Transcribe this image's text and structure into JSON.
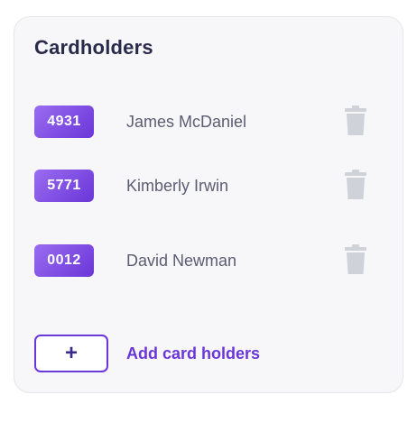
{
  "panel": {
    "title": "Cardholders",
    "cardholders": [
      {
        "card_last4": "4931",
        "name": "James McDaniel",
        "action_icon": "trash-icon"
      },
      {
        "card_last4": "5771",
        "name": "Kimberly Irwin",
        "action_icon": "trash-icon"
      },
      {
        "card_last4": "0012",
        "name": "David Newman",
        "action_icon": "trash-icon"
      }
    ],
    "add_button_symbol": "+",
    "add_label": "Add card holders"
  },
  "colors": {
    "accent": "#6a36d8",
    "badge_gradient_start": "#9a6cf0",
    "title_text": "#2a2a4a",
    "name_text": "#5c5c72",
    "trash_icon": "#cfd2d8",
    "panel_bg": "#f7f7f9"
  }
}
